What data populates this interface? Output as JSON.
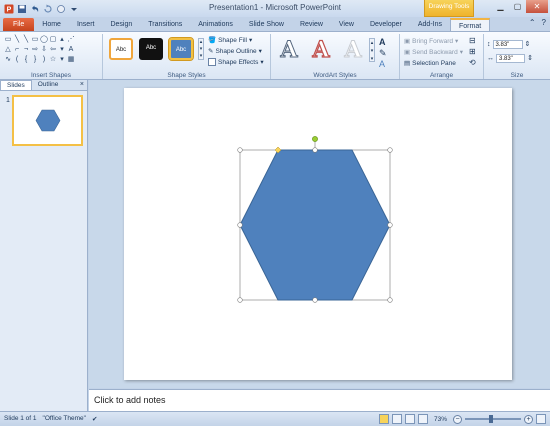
{
  "app": {
    "title": "Presentation1 - Microsoft PowerPoint",
    "context_tab_group": "Drawing Tools"
  },
  "qat": {
    "icons": [
      "powerpoint-logo-icon",
      "save-icon",
      "undo-icon",
      "redo-icon",
      "spellcheck-icon",
      "customize-qat-icon"
    ]
  },
  "tabs": [
    {
      "label": "File"
    },
    {
      "label": "Home"
    },
    {
      "label": "Insert"
    },
    {
      "label": "Design"
    },
    {
      "label": "Transitions"
    },
    {
      "label": "Animations"
    },
    {
      "label": "Slide Show"
    },
    {
      "label": "Review"
    },
    {
      "label": "View"
    },
    {
      "label": "Developer"
    },
    {
      "label": "Add-Ins"
    },
    {
      "label": "Format"
    }
  ],
  "ribbon": {
    "insert_shapes_label": "Insert Shapes",
    "shape_styles_label": "Shape Styles",
    "wordart_styles_label": "WordArt Styles",
    "arrange_label": "Arrange",
    "size_label": "Size",
    "style_sample_1": "Abc",
    "style_sample_2": "Abc",
    "style_sample_3": "Abc",
    "shape_fill": "Shape Fill",
    "shape_outline": "Shape Outline",
    "shape_effects": "Shape Effects",
    "bring_forward": "Bring Forward",
    "send_backward": "Send Backward",
    "selection_pane": "Selection Pane",
    "height_value": "3.83\"",
    "width_value": "3.83\"",
    "wordart_letter": "A"
  },
  "slides_pane": {
    "tab_slides": "Slides",
    "tab_outline": "Outline",
    "close": "×",
    "slide_number": "1"
  },
  "notes": {
    "placeholder": "Click to add notes"
  },
  "status": {
    "slide_info": "Slide 1 of 1",
    "theme": "\"Office Theme\"",
    "zoom": "73%",
    "zoom_out": "−",
    "zoom_in": "+"
  },
  "colors": {
    "hexagon_fill": "#4f81bd",
    "hexagon_outline": "#3a6596",
    "file_tab": "#d05526",
    "drawing_tools": "#f2c043"
  }
}
